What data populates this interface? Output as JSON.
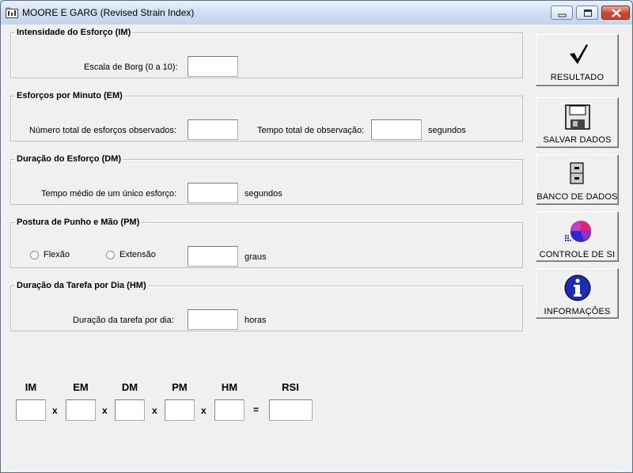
{
  "window": {
    "title": "MOORE E GARG (Revised Strain Index)"
  },
  "groups": {
    "im": {
      "title": "Intensidade do Esforço (IM)",
      "label": "Escala de Borg (0 a 10):",
      "value": ""
    },
    "em": {
      "title": "Esforços por Minuto (EM)",
      "label_count": "Número total de esforços observados:",
      "label_time": "Tempo total de observação:",
      "unit": "segundos",
      "count_value": "",
      "time_value": ""
    },
    "dm": {
      "title": "Duração do Esforço (DM)",
      "label": "Tempo médio de um único esforço:",
      "unit": "segundos",
      "value": ""
    },
    "pm": {
      "title": "Postura de Punho e Mão (PM)",
      "radio_flexion": "Flexão",
      "radio_extension": "Extensão",
      "unit": "graus",
      "value": ""
    },
    "hm": {
      "title": "Duração da Tarefa por Dia (HM)",
      "label": "Duração da tarefa por dia:",
      "unit": "horas",
      "value": ""
    }
  },
  "buttons": {
    "result": "RESULTADO",
    "save": "SALVAR DADOS",
    "database": "BANCO DE DADOS",
    "control": "CONTROLE DE SI",
    "info": "INFORMAÇÕES"
  },
  "formula": {
    "headers": [
      "IM",
      "EM",
      "DM",
      "PM",
      "HM",
      "RSI"
    ],
    "operators": [
      "x",
      "x",
      "x",
      "x",
      "="
    ]
  }
}
